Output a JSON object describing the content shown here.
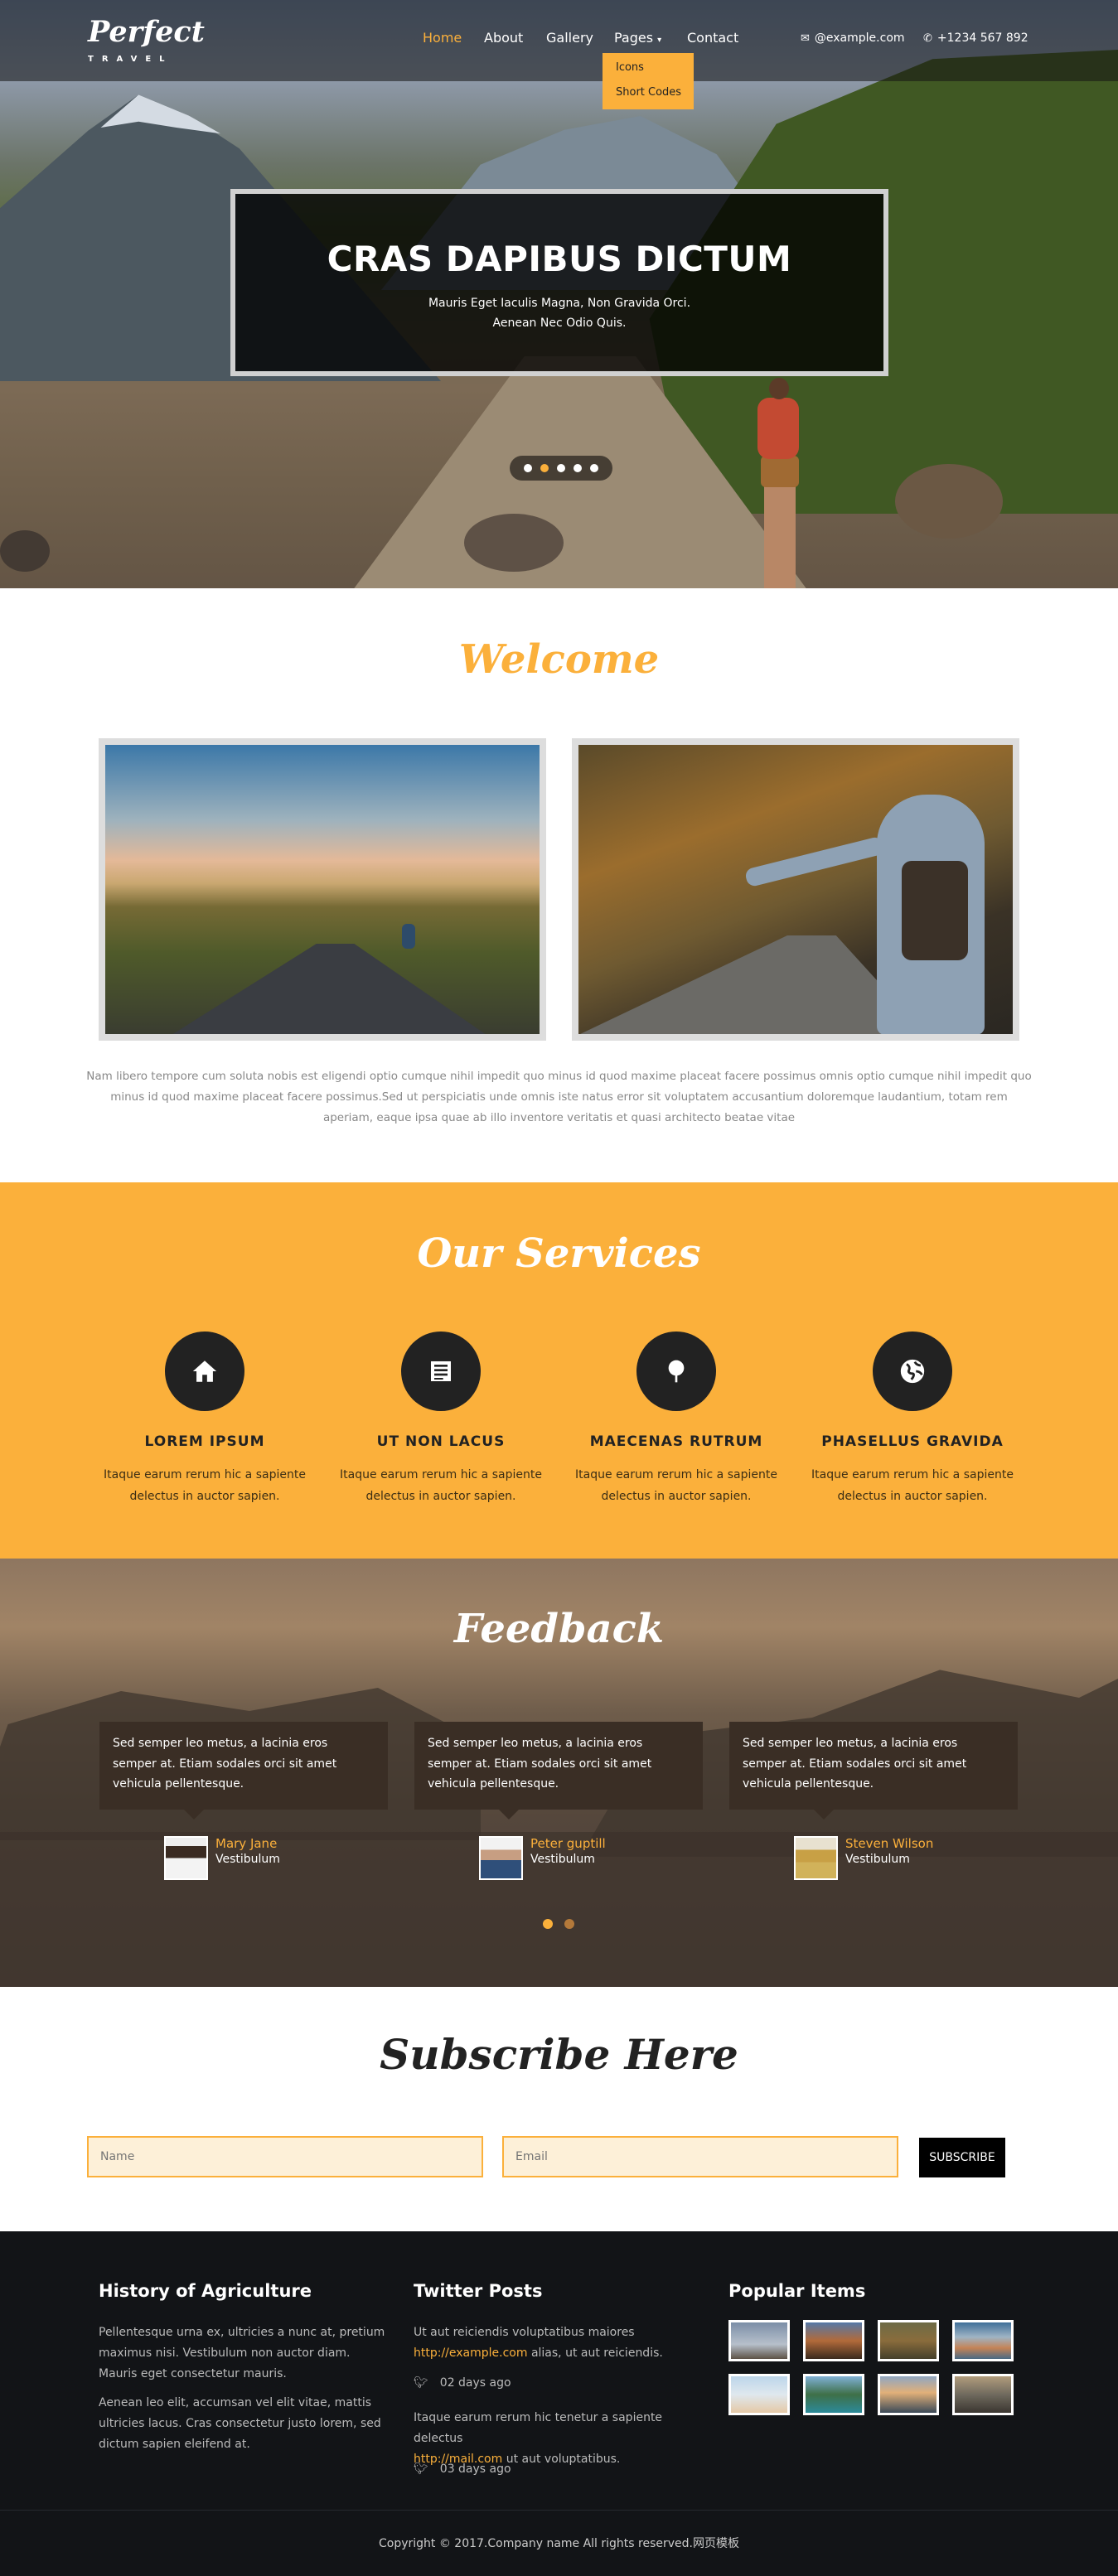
{
  "header": {
    "logo": "Perfect",
    "logo_sub": "TRAVEL",
    "nav": [
      "Home",
      "About",
      "Gallery",
      "Pages",
      "Contact"
    ],
    "dropdown": [
      "Icons",
      "Short Codes"
    ],
    "email": "@example.com",
    "phone": "+1234 567 892"
  },
  "hero": {
    "title": "CRAS DAPIBUS DICTUM",
    "line1": "Mauris Eget Iaculis Magna, Non Gravida Orci.",
    "line2": "Aenean Nec Odio Quis.",
    "slides": 5,
    "active_slide": 2
  },
  "welcome": {
    "title": "Welcome",
    "text": "Nam libero tempore cum soluta nobis est eligendi optio cumque nihil impedit quo minus id quod maxime placeat facere possimus omnis optio cumque nihil impedit quo minus id quod maxime placeat facere possimus.Sed ut perspiciatis unde omnis iste natus error sit voluptatem accusantium doloremque laudantium, totam rem aperiam, eaque ipsa quae ab illo inventore veritatis et quasi architecto beatae vitae"
  },
  "services": {
    "title": "Our Services",
    "items": [
      {
        "icon": "home-icon",
        "title": "LOREM IPSUM",
        "line1": "Itaque earum rerum hic a sapiente",
        "line2": "delectus in auctor sapien."
      },
      {
        "icon": "list-icon",
        "title": "UT NON LACUS",
        "line1": "Itaque earum rerum hic a sapiente",
        "line2": "delectus in auctor sapien."
      },
      {
        "icon": "tree-icon",
        "title": "MAECENAS RUTRUM",
        "line1": "Itaque earum rerum hic a sapiente",
        "line2": "delectus in auctor sapien."
      },
      {
        "icon": "globe-icon",
        "title": "PHASELLUS GRAVIDA",
        "line1": "Itaque earum rerum hic a sapiente",
        "line2": "delectus in auctor sapien."
      }
    ]
  },
  "feedback": {
    "title": "Feedback",
    "items": [
      {
        "text": "Sed semper leo metus, a lacinia eros semper at. Etiam sodales orci sit amet vehicula pellentesque.",
        "name": "Mary Jane",
        "role": "Vestibulum"
      },
      {
        "text": "Sed semper leo metus, a lacinia eros semper at. Etiam sodales orci sit amet vehicula pellentesque.",
        "name": "Peter guptill",
        "role": "Vestibulum"
      },
      {
        "text": "Sed semper leo metus, a lacinia eros semper at. Etiam sodales orci sit amet vehicula pellentesque.",
        "name": "Steven Wilson",
        "role": "Vestibulum"
      }
    ]
  },
  "subscribe": {
    "title": "Subscribe Here",
    "name_placeholder": "Name",
    "email_placeholder": "Email",
    "button": "SUBSCRIBE"
  },
  "footer": {
    "col1": {
      "title": "History of Agriculture",
      "p1": "Pellentesque urna ex, ultricies a nunc at, pretium maximus nisi. Vestibulum non auctor diam. Mauris eget consectetur mauris.",
      "p2": "Aenean leo elit, accumsan vel elit vitae, mattis ultricies lacus. Cras consectetur justo lorem, sed dictum sapien eleifend at."
    },
    "col2": {
      "title": "Twitter Posts",
      "t1_a": "Ut aut reiciendis voluptatibus maiores",
      "t1_link": "http://example.com",
      "t1_b": " alias, ut aut reiciendis.",
      "t1_time": "02 days ago",
      "t2_a": "Itaque earum rerum hic tenetur a sapiente delectus",
      "t2_link": "http://mail.com",
      "t2_b": " ut aut voluptatibus.",
      "t2_time": "03 days ago"
    },
    "col3": {
      "title": "Popular Items"
    },
    "copyright": "Copyright © 2017.Company name All rights reserved.网页模板"
  },
  "colors": {
    "accent": "#fbb03b",
    "dark": "#121417"
  }
}
